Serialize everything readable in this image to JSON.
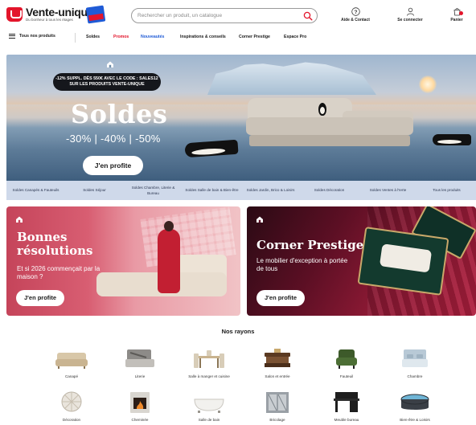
{
  "header": {
    "brand": "Vente-unique",
    "tagline": "Du bonheur à tous les étages",
    "search_placeholder": "Rechercher un produit, un catalogue",
    "help_label": "Aide & Contact",
    "account_label": "Se connecter",
    "cart_label": "Panier"
  },
  "nav": {
    "all_products": "Tous nos produits",
    "items": [
      "Soldes",
      "Promos",
      "Nouveautés",
      "Inspirations & conseils",
      "Corner Prestige",
      "Espace Pro"
    ],
    "colors": [
      "#1a1a1a",
      "#e3152b",
      "#1f5bd6",
      "#1a1a1a",
      "#1a1a1a",
      "#1a1a1a"
    ]
  },
  "hero": {
    "promo_line1": "-12% SUPPL. DÈS 550€ AVEC LE CODE : SALES12",
    "promo_line2": "SUR LES PRODUITS VENTE-UNIQUE",
    "title": "Soldes",
    "percentages": "-30% | -40% | -50%",
    "cta": "J'en profite"
  },
  "subnav": [
    "Soldes Canapés & Fauteuils",
    "Soldes Séjour",
    "Soldes Chambre, Literie & Bureau",
    "Soldes Salle de bain & Bien-être",
    "Soldes Jardin, Brico & Loisirs",
    "Soldes Décoration",
    "Soldes Ventes à l'Ierte",
    "Tous les produits"
  ],
  "cards": [
    {
      "title": "Bonnes résolutions",
      "subtitle": "Et si 2026 commençait par la maison ?",
      "cta": "J'en profite"
    },
    {
      "title": "Corner Prestige",
      "subtitle": "Le mobilier d'exception à portée de tous",
      "cta": "J'en profite"
    }
  ],
  "rayons": {
    "title": "Nos rayons",
    "items": [
      {
        "label": "Canapé",
        "icon": "sofa-icon"
      },
      {
        "label": "Literie",
        "icon": "bed-icon"
      },
      {
        "label": "Salle à manger et cuisine",
        "icon": "dining-table-icon"
      },
      {
        "label": "Salon et entrée",
        "icon": "coffee-table-icon"
      },
      {
        "label": "Fauteuil",
        "icon": "armchair-icon"
      },
      {
        "label": "Chambre",
        "icon": "bedroom-icon"
      },
      {
        "label": "Décoration",
        "icon": "decoration-icon"
      },
      {
        "label": "Cheminée",
        "icon": "fireplace-icon"
      },
      {
        "label": "Salle de bain",
        "icon": "bathtub-icon"
      },
      {
        "label": "Bricolage",
        "icon": "tools-icon"
      },
      {
        "label": "Meuble bureau",
        "icon": "desk-icon"
      },
      {
        "label": "Bien-être & Loisirs",
        "icon": "spa-icon"
      }
    ]
  },
  "colors": {
    "brand_red": "#e3152b",
    "nav_blue": "#1f5bd6",
    "subnav_bg": "#cfd9ea",
    "card_left": "#d85e72",
    "card_right": "#5c0f24"
  }
}
